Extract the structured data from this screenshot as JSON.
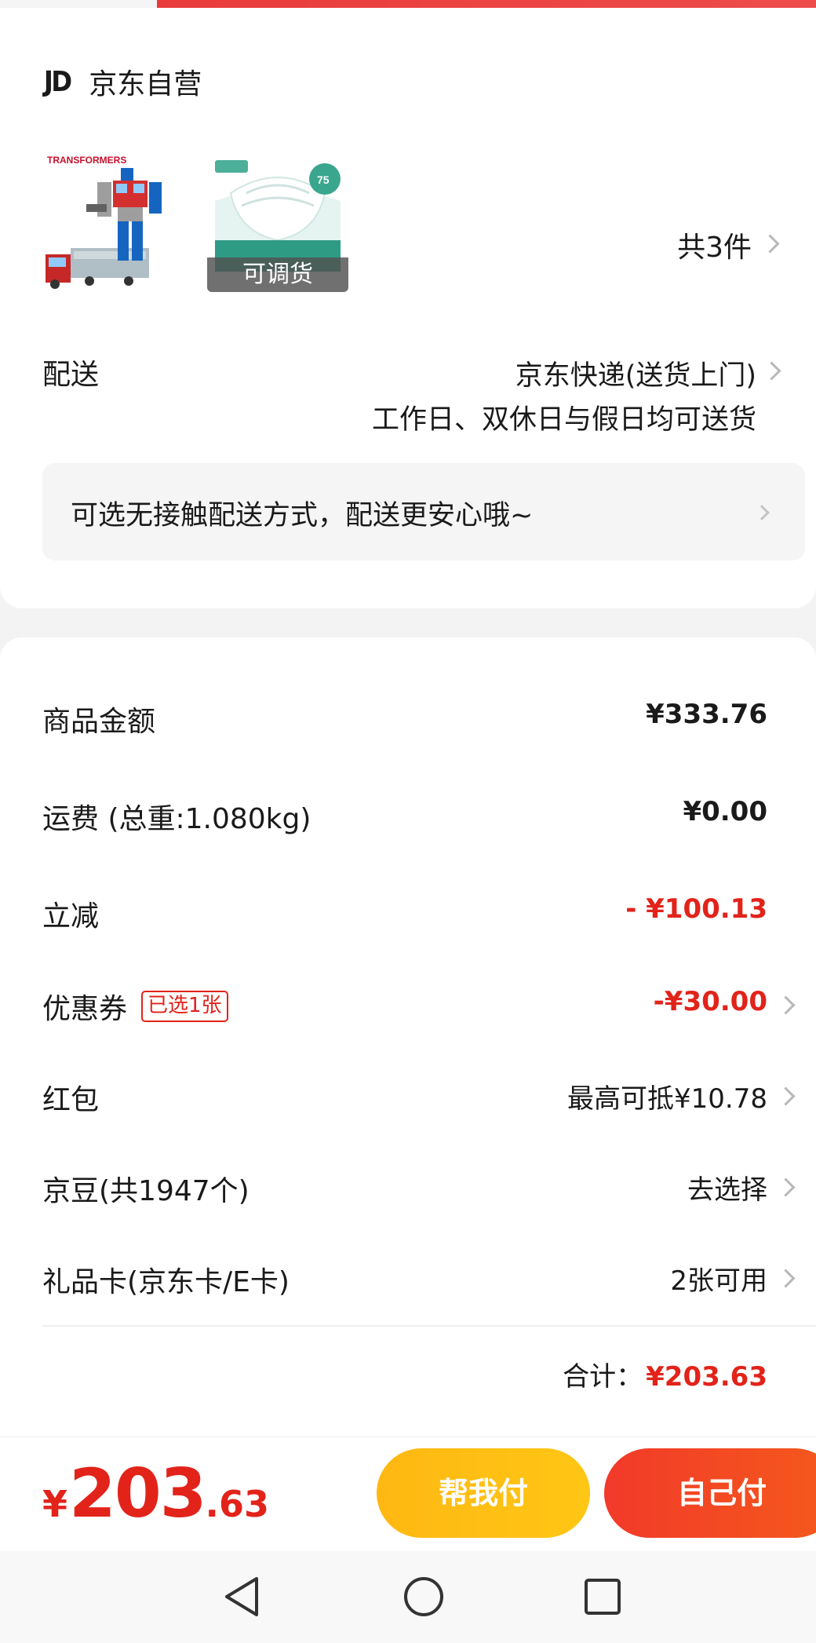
{
  "store": {
    "logo": "JD",
    "name": "京东自营"
  },
  "items": {
    "thumb1_caption": "TRANSFORMERS",
    "thumb2_tag": "可调货",
    "count": "共3件"
  },
  "delivery": {
    "label": "配送",
    "method": "京东快递(送货上门)",
    "time": "工作日、双休日与假日均可送货"
  },
  "contactless": {
    "text": "可选无接触配送方式，配送更安心哦~"
  },
  "price_rows": {
    "goods": {
      "label": "商品金额",
      "value": "¥333.76"
    },
    "shipping": {
      "label": "运费  (总重:1.080kg)",
      "value": "¥0.00"
    },
    "instant": {
      "label": "立减",
      "value": "- ¥100.13"
    },
    "coupon": {
      "label": "优惠券",
      "badge": "已选1张",
      "value": "-¥30.00"
    },
    "red_packet": {
      "label": "红包",
      "value": "最高可抵¥10.78"
    },
    "jd_beans": {
      "label": "京豆(共1947个)",
      "value": "去选择"
    },
    "gift_card": {
      "label": "礼品卡(京东卡/E卡)",
      "value": "2张可用"
    }
  },
  "total": {
    "label": "合计：",
    "amount": "¥203.63"
  },
  "pay": {
    "symbol": "¥",
    "integer": "203",
    "decimal": ".63",
    "help_button": "帮我付",
    "self_button": "自己付"
  },
  "colors": {
    "accent_red": "#e2231a",
    "help_yellow": "#ffc014",
    "self_red": "#f2452a"
  },
  "icons": {
    "back": "triangle-back-icon",
    "home": "circle-home-icon",
    "recent": "square-recent-icon"
  }
}
